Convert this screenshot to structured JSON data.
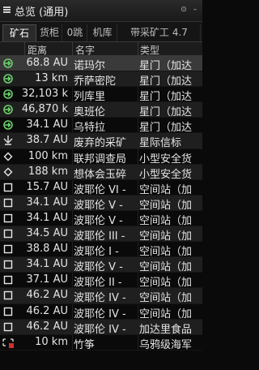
{
  "window": {
    "title": "总览 (通用)"
  },
  "tabs": [
    "矿石",
    "货柜",
    "0跳",
    "机库",
    "带采矿工 4.7"
  ],
  "columns": {
    "icon": "",
    "distance": "距离",
    "name": "名字",
    "type": "类型"
  },
  "rows": [
    {
      "icon": "gate-jump-icon",
      "distance": "68.8 AU",
      "name": "诺玛尔",
      "type": "星门（加达",
      "selected": true
    },
    {
      "icon": "gate-jump-icon",
      "distance": "13 km",
      "name": "乔萨密陀",
      "type": "星门（加达"
    },
    {
      "icon": "gate-jump-icon",
      "distance": "32,103 k",
      "name": "列库里",
      "type": "星门（加达"
    },
    {
      "icon": "gate-jump-icon",
      "distance": "46,870 k",
      "name": "奥班伦",
      "type": "星门（加达"
    },
    {
      "icon": "gate-jump-icon",
      "distance": "34.1 AU",
      "name": "乌特拉",
      "type": "星门（加达"
    },
    {
      "icon": "beacon-icon",
      "distance": "38.7 AU",
      "name": "废弃的采矿",
      "type": "星际信标"
    },
    {
      "icon": "diamond-icon",
      "distance": "100 km",
      "name": "联邦调查局",
      "type": "小型安全货"
    },
    {
      "icon": "diamond-icon",
      "distance": "188 km",
      "name": "想体会玉碎",
      "type": "小型安全货"
    },
    {
      "icon": "square-icon",
      "distance": "15.7 AU",
      "name": "波耶伦 VI -",
      "type": "空间站（加"
    },
    {
      "icon": "square-icon",
      "distance": "34.1 AU",
      "name": "波耶伦 V -",
      "type": "空间站（加"
    },
    {
      "icon": "square-icon",
      "distance": "34.1 AU",
      "name": "波耶伦 V -",
      "type": "空间站（加"
    },
    {
      "icon": "square-icon",
      "distance": "34.5 AU",
      "name": "波耶伦 III -",
      "type": "空间站（加"
    },
    {
      "icon": "square-icon",
      "distance": "38.8 AU",
      "name": "波耶伦 I -",
      "type": "空间站（加"
    },
    {
      "icon": "square-icon",
      "distance": "34.1 AU",
      "name": "波耶伦 V -",
      "type": "空间站（加"
    },
    {
      "icon": "square-icon",
      "distance": "37.1 AU",
      "name": "波耶伦 II -",
      "type": "空间站（加"
    },
    {
      "icon": "square-icon",
      "distance": "46.2 AU",
      "name": "波耶伦 IV -",
      "type": "空间站（加"
    },
    {
      "icon": "square-icon",
      "distance": "46.2 AU",
      "name": "波耶伦 IV -",
      "type": "空间站（加"
    },
    {
      "icon": "square-icon",
      "distance": "46.2 AU",
      "name": "波耶伦 IV -",
      "type": "加达里食品"
    },
    {
      "icon": "ship-icon",
      "distance": "10 km",
      "name": "竹筝",
      "type": "乌鸦级海军"
    }
  ],
  "colors": {
    "accent_green": "#6cd16c",
    "row_selected": "#3a3a3a"
  }
}
